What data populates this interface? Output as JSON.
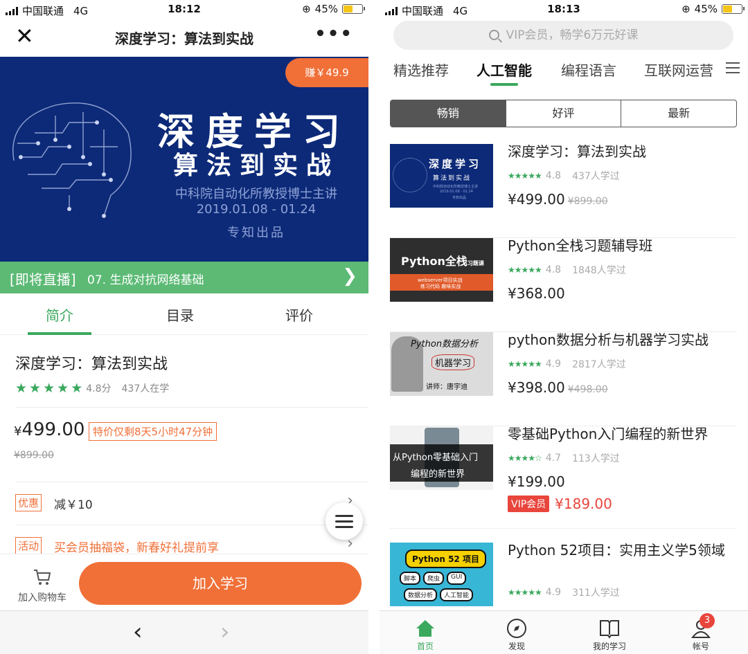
{
  "left": {
    "status": {
      "carrier": "中国联通",
      "network": "4G",
      "time": "18:12",
      "battery": "45%"
    },
    "nav": {
      "title": "深度学习：算法到实战",
      "close_icon": "close-icon",
      "more_icon": "more-icon"
    },
    "banner": {
      "earn": "赚￥49.9",
      "line1": "深度学习",
      "line2": "算法到实战",
      "line3": "中科院自动化所教授博士主讲",
      "line4": "2019.01.08 - 01.24",
      "line5": "专知出品"
    },
    "live": {
      "tag": "[即将直播]",
      "text": "07. 生成对抗网络基础"
    },
    "tabs": [
      "简介",
      "目录",
      "评价"
    ],
    "course": {
      "title": "深度学习：算法到实战",
      "score": "4.8分",
      "learners": "437人在学",
      "price_symbol": "¥",
      "price": "499.00",
      "countdown": "特价仅剩8天5小时47分钟",
      "old_price": "¥899.00"
    },
    "promo": {
      "label": "优惠",
      "text": "减￥10"
    },
    "activity": {
      "label": "活动",
      "text": "买会员抽福袋，新春好礼提前享"
    },
    "bottom": {
      "cart": "加入购物车",
      "join": "加入学习"
    }
  },
  "right": {
    "status": {
      "carrier": "中国联通",
      "network": "4G",
      "time": "18:13",
      "battery": "45%"
    },
    "search": {
      "placeholder": "VIP会员，畅学6万元好课"
    },
    "categories": [
      "精选推荐",
      "人工智能",
      "编程语言",
      "互联网运营"
    ],
    "sort": [
      "畅销",
      "好评",
      "最新"
    ],
    "courses": [
      {
        "title": "深度学习：算法到实战",
        "rating": "4.8",
        "learners": "437人学过",
        "price": "¥499.00",
        "old_price": "¥899.00"
      },
      {
        "title": "Python全栈习题辅导班",
        "rating": "4.8",
        "learners": "1848人学过",
        "price": "¥368.00",
        "old_price": ""
      },
      {
        "title": "python数据分析与机器学习实战",
        "rating": "4.9",
        "learners": "2817人学过",
        "price": "¥398.00",
        "old_price": "¥498.00"
      },
      {
        "title": "零基础Python入门编程的新世界",
        "rating": "4.7",
        "learners": "113人学过",
        "price": "¥199.00",
        "old_price": "",
        "vip_label": "VIP会员",
        "vip_price": "¥189.00"
      },
      {
        "title": "Python 52项目：实用主义学5领域",
        "rating": "4.9",
        "learners": "311人学过",
        "price": "",
        "old_price": ""
      }
    ],
    "thumbs": {
      "t1": {
        "l1": "深度学习",
        "l2": "算法到实战",
        "l3": "中科院自动化所教授博士主讲",
        "l4": "2019.01.08 - 01.24",
        "l5": "专知出品"
      },
      "t2": {
        "main": "Python全栈",
        "sub": "习题课",
        "b1": "webserver项目实战",
        "b2": "练习代码 趣味实战"
      },
      "t3": {
        "a": "Python数据分析",
        "b": "机器学习",
        "c": "讲师：唐宇迪"
      },
      "t4": {
        "a": "从Python零基础入门",
        "b": "编程的新世界"
      },
      "t5": {
        "a": "Python 52 项目",
        "tags": [
          "脚本",
          "爬虫",
          "GUI",
          "数据分析",
          "人工智能"
        ]
      }
    },
    "tabbar": [
      "首页",
      "发现",
      "我的学习",
      "帐号"
    ],
    "badge": "3"
  }
}
